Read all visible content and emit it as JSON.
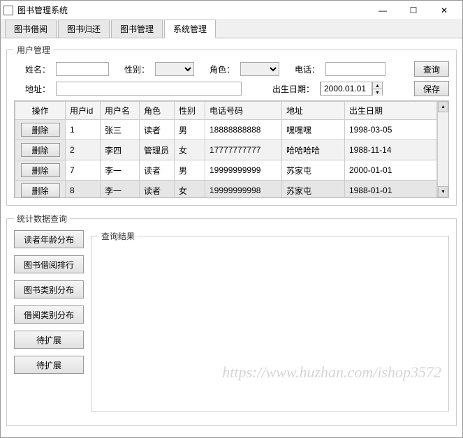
{
  "window": {
    "title": "图书管理系统",
    "minimize": "—",
    "maximize": "☐",
    "close": "✕"
  },
  "tabs": [
    {
      "label": "图书借阅"
    },
    {
      "label": "图书归还"
    },
    {
      "label": "图书管理"
    },
    {
      "label": "系统管理"
    }
  ],
  "active_tab": 3,
  "user_mgmt": {
    "legend": "用户管理",
    "labels": {
      "name": "姓名：",
      "gender": "性别：",
      "role": "角色：",
      "phone": "电话：",
      "address": "地址：",
      "birth": "出生日期："
    },
    "buttons": {
      "query": "查询",
      "save": "保存"
    },
    "birth_value": "2000.01.01",
    "spin_up": "▴",
    "spin_down": "▾",
    "table": {
      "headers": [
        "操作",
        "用户id",
        "用户名",
        "角色",
        "性别",
        "电话号码",
        "地址",
        "出生日期"
      ],
      "delete_label": "删除",
      "rows": [
        {
          "id": "1",
          "name": "张三",
          "role": "读者",
          "gender": "男",
          "phone": "18888888888",
          "address": "嘿嘿嘿",
          "birth": "1998-03-05"
        },
        {
          "id": "2",
          "name": "李四",
          "role": "管理员",
          "gender": "女",
          "phone": "17777777777",
          "address": "哈哈哈哈",
          "birth": "1988-11-14"
        },
        {
          "id": "7",
          "name": "李一",
          "role": "读者",
          "gender": "男",
          "phone": "19999999999",
          "address": "苏家屯",
          "birth": "2000-01-01"
        },
        {
          "id": "8",
          "name": "李一",
          "role": "读者",
          "gender": "女",
          "phone": "19999999998",
          "address": "苏家屯",
          "birth": "1988-01-01"
        }
      ]
    },
    "scroll_up": "▴",
    "scroll_down": "▾"
  },
  "stats": {
    "legend": "统计数据查询",
    "results_legend": "查询结果",
    "buttons": [
      "读者年龄分布",
      "图书借阅排行",
      "图书类别分布",
      "借阅类别分布",
      "待扩展",
      "待扩展"
    ]
  },
  "watermark": "https://www.huzhan.com/ishop3572"
}
